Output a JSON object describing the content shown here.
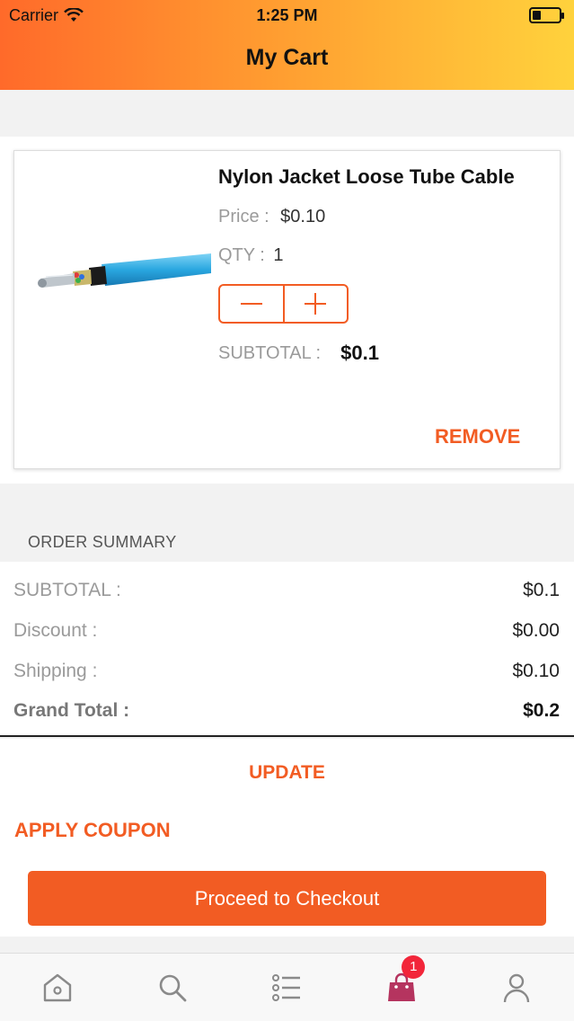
{
  "status_bar": {
    "carrier": "Carrier",
    "time": "1:25 PM"
  },
  "header": {
    "title": "My Cart"
  },
  "cart": {
    "items": [
      {
        "name": "Nylon Jacket Loose Tube Cable",
        "price_label": "Price :",
        "price": "$0.10",
        "qty_label": "QTY : ",
        "qty": "1",
        "subtotal_label": "SUBTOTAL :",
        "subtotal": "$0.1",
        "remove_label": "REMOVE",
        "image_icon": "cable-product-image"
      }
    ]
  },
  "summary": {
    "heading": "ORDER SUMMARY",
    "rows": [
      {
        "label": "SUBTOTAL :",
        "value": "$0.1"
      },
      {
        "label": "Discount :",
        "value": "$0.00"
      },
      {
        "label": "Shipping :",
        "value": "$0.10"
      },
      {
        "label": "Grand Total :",
        "value": "$0.2"
      }
    ]
  },
  "actions": {
    "update_label": "UPDATE",
    "coupon_label": "APPLY COUPON",
    "checkout_label": "Proceed to Checkout"
  },
  "tabbar": {
    "items": [
      {
        "icon": "home-icon"
      },
      {
        "icon": "search-icon"
      },
      {
        "icon": "list-icon"
      },
      {
        "icon": "cart-bag-icon",
        "badge": "1"
      },
      {
        "icon": "profile-icon"
      }
    ]
  },
  "colors": {
    "accent": "#f25c23",
    "badge": "#f2263a",
    "cart_icon": "#b5345f"
  }
}
